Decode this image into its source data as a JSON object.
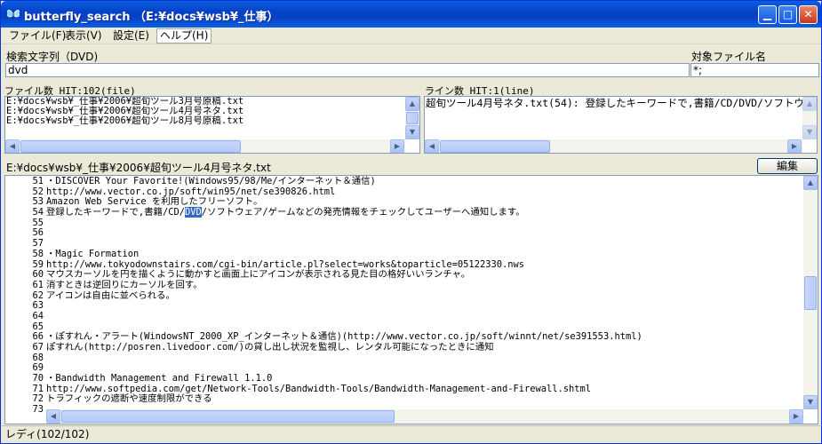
{
  "window": {
    "title": "butterfly_search （E:¥docs¥wsb¥_仕事）"
  },
  "menu": [
    "ファイル(F)",
    "表示(V)",
    "設定(E)",
    "ヘルプ(H)"
  ],
  "search": {
    "label": "検索文字列（DVD)",
    "value": "dvd"
  },
  "target": {
    "label": "対象ファイル名",
    "value": "*;"
  },
  "files": {
    "header": "ファイル数  HIT:102(file)",
    "items": [
      "E:¥docs¥wsb¥_仕事¥2006¥超旬ツール3月号原稿.txt",
      "E:¥docs¥wsb¥_仕事¥2006¥超旬ツール4月号ネタ.txt",
      "E:¥docs¥wsb¥_仕事¥2006¥超旬ツール8月号原稿.txt"
    ]
  },
  "lines": {
    "header": "ライン数 HIT:1(line)",
    "items": [
      "超旬ツール4月号ネタ.txt(54): 登録したキーワードで,書籍/CD/DVD/ソフトウ"
    ]
  },
  "current_file": {
    "path": "E:¥docs¥wsb¥_仕事¥2006¥超旬ツール4月号ネタ.txt",
    "edit_label": "編集"
  },
  "editor": {
    "lines": [
      {
        "num": "51",
        "text": "・DISCOVER Your Favorite!(Windows95/98/Me/インターネット＆通信)"
      },
      {
        "num": "52",
        "text": "http://www.vector.co.jp/soft/win95/net/se390826.html"
      },
      {
        "num": "53",
        "text": "Amazon Web Service を利用したフリーソフト。"
      },
      {
        "num": "54",
        "pre": "登録したキーワードで,書籍/CD/",
        "match": "DVD",
        "post": "/ソフトウェア/ゲームなどの発売情報をチェックしてユーザーへ通知します。"
      },
      {
        "num": "55",
        "text": ""
      },
      {
        "num": "56",
        "text": ""
      },
      {
        "num": "57",
        "text": ""
      },
      {
        "num": "58",
        "text": "・Magic Formation"
      },
      {
        "num": "59",
        "text": "http://www.tokyodownstairs.com/cgi-bin/article.pl?select=works&toparticle=05122330.nws"
      },
      {
        "num": "60",
        "text": "マウスカーソルを円を描くように動かすと画面上にアイコンが表示される見た目の格好いいランチャ。"
      },
      {
        "num": "61",
        "text": "消すときは逆回りにカーソルを回す。"
      },
      {
        "num": "62",
        "text": "アイコンは自由に並べられる。"
      },
      {
        "num": "63",
        "text": ""
      },
      {
        "num": "64",
        "text": ""
      },
      {
        "num": "65",
        "text": ""
      },
      {
        "num": "66",
        "text": "・ぽすれん・アラート(WindowsNT_2000_XP_インターネット＆通信)(http://www.vector.co.jp/soft/winnt/net/se391553.html)"
      },
      {
        "num": "67",
        "text": "ぽすれん(http://posren.livedoor.com/)の貸し出し状況を監視し、レンタル可能になったときに通知"
      },
      {
        "num": "68",
        "text": ""
      },
      {
        "num": "69",
        "text": ""
      },
      {
        "num": "70",
        "text": "・Bandwidth Management and Firewall 1.1.0"
      },
      {
        "num": "71",
        "text": "http://www.softpedia.com/get/Network-Tools/Bandwidth-Tools/Bandwidth-Management-and-Firewall.shtml"
      },
      {
        "num": "72",
        "text": "トラフィックの遮断や速度制限ができる"
      },
      {
        "num": "73",
        "text": ""
      }
    ]
  },
  "status": "レディ(102/102)"
}
